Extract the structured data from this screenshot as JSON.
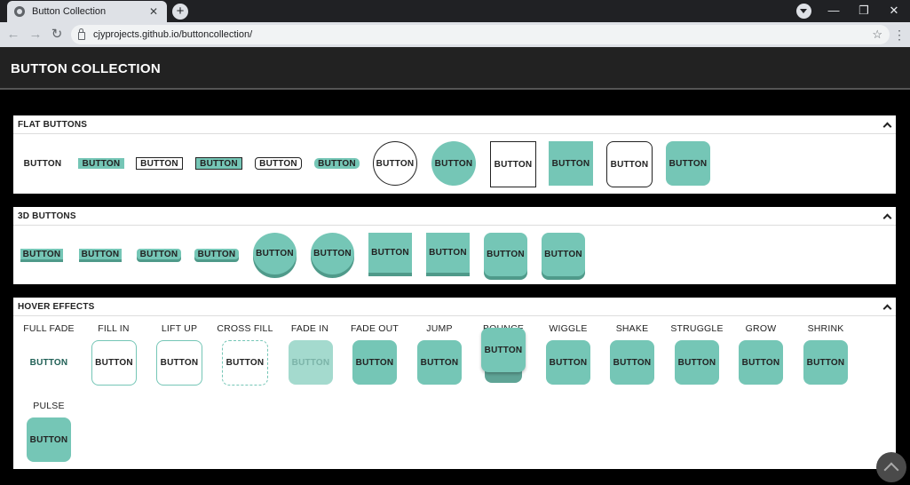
{
  "browser": {
    "tab_title": "Button Collection",
    "tab_close": "✕",
    "new_tab": "+",
    "url": "cjyprojects.github.io/buttoncollection/",
    "back": "←",
    "forward": "→",
    "reload": "↻",
    "star": "☆",
    "menu": "⋮",
    "win_min": "—",
    "win_max": "❐",
    "win_close": "✕"
  },
  "page": {
    "title": "BUTTON COLLECTION"
  },
  "flat": {
    "title": "FLAT BUTTONS",
    "button": "BUTTON"
  },
  "threed": {
    "title": "3D BUTTONS",
    "button": "BUTTON"
  },
  "hover": {
    "title": "HOVER EFFECTS",
    "button": "BUTTON",
    "labels": [
      "FULL FADE",
      "FILL IN",
      "LIFT UP",
      "CROSS FILL",
      "FADE IN",
      "FADE OUT",
      "JUMP",
      "BOUNCE",
      "WIGGLE",
      "SHAKE",
      "STRUGGLE",
      "GROW",
      "SHRINK",
      "PULSE"
    ]
  },
  "colors": {
    "accent": "#75c6b6",
    "accent_dark": "#4f9a8a",
    "header_bg": "#222222"
  }
}
